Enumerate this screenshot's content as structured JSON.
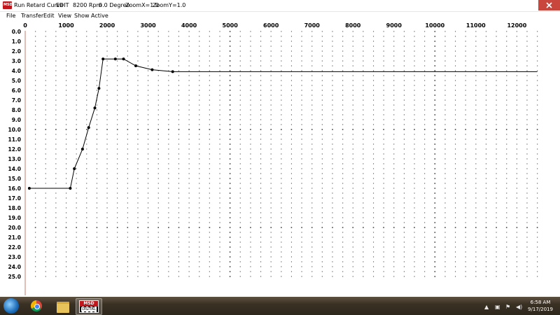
{
  "window": {
    "title_parts": [
      "Run Retard Curve",
      "EDIT",
      "8200 Rpm",
      "0.0 Degree",
      "ZoomX=1.0",
      "ZoomY=1.0"
    ],
    "app_icon_text": "MSD"
  },
  "menu": [
    "File",
    "Transfer",
    "Edit",
    "View",
    "Show",
    "Active"
  ],
  "colors": {
    "grid_dot": "#444444",
    "curve": "#000000",
    "accent_red": "#c0161c",
    "axis_line": "#c87a6e"
  },
  "chart_data": {
    "type": "line",
    "x_ticks": [
      "0",
      "1000",
      "2000",
      "3000",
      "4000",
      "5000",
      "6000",
      "7000",
      "8000",
      "9000",
      "10000",
      "11000",
      "12000"
    ],
    "y_ticks": [
      "0.0",
      "1.0",
      "2.0",
      "3.0",
      "4.0",
      "5.0",
      "6.0",
      "7.0",
      "8.0",
      "9.0",
      "10.0",
      "11.0",
      "12.0",
      "13.0",
      "14.0",
      "15.0",
      "16.0",
      "17.0",
      "18.0",
      "19.0",
      "20.0",
      "21.0",
      "22.0",
      "23.0",
      "24.0",
      "25.0"
    ],
    "xlim": [
      0,
      12500
    ],
    "ylim": [
      0,
      25
    ],
    "y_inverted": true,
    "grid": "dotted",
    "series": [
      {
        "x": [
          100,
          1100,
          1200,
          1400,
          1550,
          1700,
          1800,
          1900,
          2200,
          2400,
          2700,
          3100,
          3600,
          12500
        ],
        "y": [
          16.0,
          16.0,
          14.0,
          12.0,
          9.8,
          7.8,
          5.8,
          2.8,
          2.8,
          2.8,
          3.5,
          3.9,
          4.1,
          4.1
        ],
        "markers": [
          true,
          true,
          true,
          true,
          true,
          true,
          true,
          true,
          true,
          true,
          true,
          true,
          true,
          false
        ]
      }
    ]
  },
  "taskbar": {
    "apps": [
      "chrome",
      "explorer",
      "msd"
    ],
    "msd_top": "MSD",
    "msd_bottom": "DIGITAL",
    "tray_icons": [
      "up-arrow-icon",
      "network-icon",
      "flag-icon",
      "volume-icon"
    ],
    "clock_time": "6:58 AM",
    "clock_date": "9/17/2019"
  }
}
